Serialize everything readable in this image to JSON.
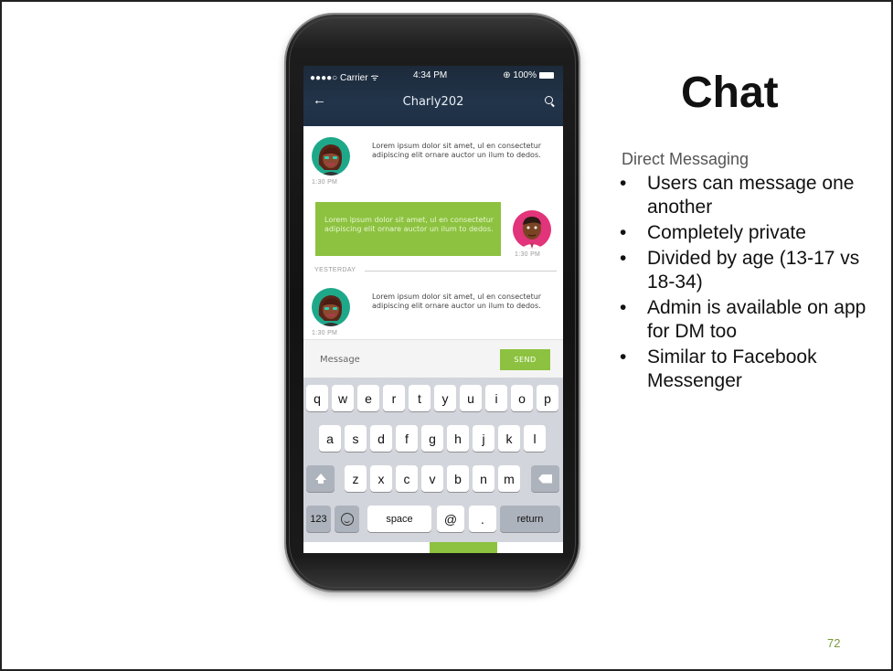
{
  "status_bar": {
    "carrier": "●●●●○ Carrier ᯤ",
    "time": "4:34 PM",
    "battery": "⊕ 100%"
  },
  "chat_header": {
    "title": "Charly202",
    "back_icon": "←"
  },
  "messages": [
    {
      "text": "Lorem ipsum dolor sit amet, ul en consectetur adipiscing elit ornare auctor  un ilum to dedos.",
      "time": "1:30 PM",
      "sender": "other"
    },
    {
      "text": "Lorem ipsum dolor sit amet, ul en consectetur adipiscing elit ornare auctor  un ilum to dedos.",
      "time": "1:30 PM",
      "sender": "me"
    },
    {
      "text": "Lorem ipsum dolor sit amet, ul en consectetur adipiscing elit ornare auctor  un ilum to dedos.",
      "time": "1:30 PM",
      "sender": "other"
    }
  ],
  "divider_label": "YESTERDAY",
  "composer": {
    "placeholder": "Message",
    "send_label": "SEND"
  },
  "keyboard": {
    "row1": [
      "q",
      "w",
      "e",
      "r",
      "t",
      "y",
      "u",
      "i",
      "o",
      "p"
    ],
    "row2": [
      "a",
      "s",
      "d",
      "f",
      "g",
      "h",
      "j",
      "k",
      "l"
    ],
    "row3": [
      "z",
      "x",
      "c",
      "v",
      "b",
      "n",
      "m"
    ],
    "numbers": "123",
    "space": "space",
    "at": "@",
    "period": ".",
    "return": "return"
  },
  "slide": {
    "title": "Chat",
    "subtitle": "Direct Messaging",
    "bullets": [
      "Users can message one another",
      "Completely private",
      "Divided by age (13-17 vs 18-34)",
      "Admin is available on app for DM too",
      "Similar to Facebook Messenger"
    ],
    "bullet_char": "•",
    "page_number": "72"
  },
  "colors": {
    "accent_green": "#8cc23f",
    "header_navy": "#1f3045",
    "page_number": "#7a9a3a"
  }
}
